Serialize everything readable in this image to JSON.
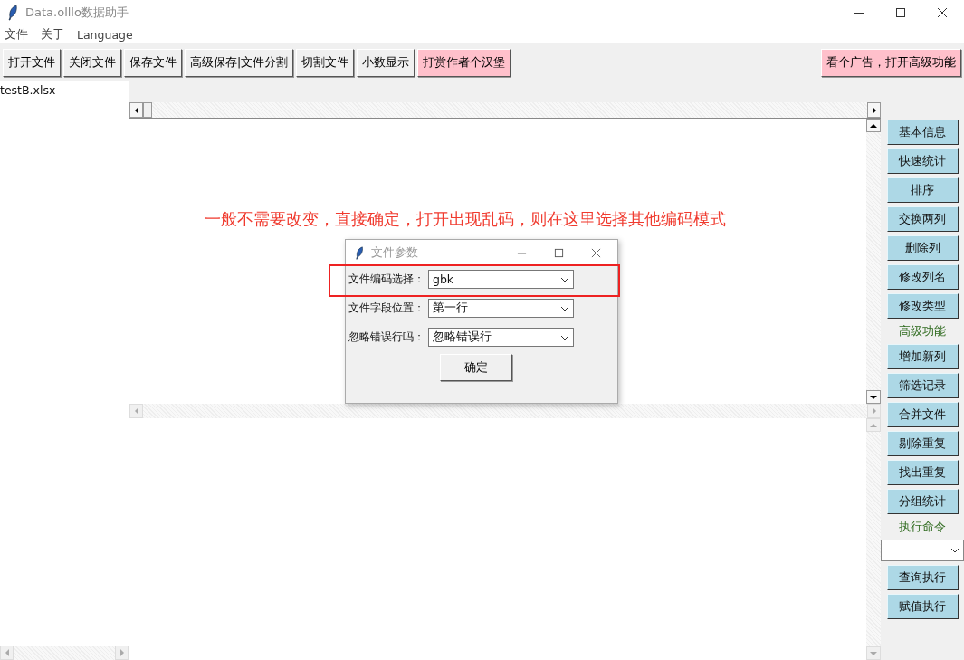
{
  "window": {
    "title": "Data.olllo数据助手"
  },
  "menu": [
    {
      "label": "文件"
    },
    {
      "label": "关于"
    },
    {
      "label": "Language"
    }
  ],
  "toolbar": {
    "buttons": [
      {
        "label": "打开文件",
        "kind": "normal"
      },
      {
        "label": "关闭文件",
        "kind": "normal"
      },
      {
        "label": "保存文件",
        "kind": "normal"
      },
      {
        "label": "高级保存|文件分割",
        "kind": "normal"
      },
      {
        "label": "切割文件",
        "kind": "normal"
      },
      {
        "label": "小数显示",
        "kind": "normal"
      },
      {
        "label": "打赏作者个汉堡",
        "kind": "pink"
      }
    ],
    "right_button": {
      "label": "看个广告，打开高级功能",
      "kind": "pink"
    }
  },
  "file_list": [
    "testB.xlsx"
  ],
  "annotation": "一般不需要改变，直接确定，打开出现乱码，则在这里选择其他编码模式",
  "dialog": {
    "title": "文件参数",
    "fields": [
      {
        "label": "文件编码选择：",
        "value": "gbk"
      },
      {
        "label": "文件字段位置：",
        "value": "第一行"
      },
      {
        "label": "忽略错误行吗：",
        "value": "忽略错误行"
      }
    ],
    "confirm": "确定"
  },
  "side_panel": [
    {
      "kind": "button",
      "label": "基本信息"
    },
    {
      "kind": "button",
      "label": "快速统计"
    },
    {
      "kind": "button",
      "label": "排序"
    },
    {
      "kind": "button",
      "label": "交换两列"
    },
    {
      "kind": "button",
      "label": "删除列"
    },
    {
      "kind": "button",
      "label": "修改列名"
    },
    {
      "kind": "button",
      "label": "修改类型"
    },
    {
      "kind": "heading",
      "label": "高级功能"
    },
    {
      "kind": "button",
      "label": "增加新列"
    },
    {
      "kind": "button",
      "label": "筛选记录"
    },
    {
      "kind": "button",
      "label": "合并文件"
    },
    {
      "kind": "button",
      "label": "剔除重复"
    },
    {
      "kind": "button",
      "label": "找出重复"
    },
    {
      "kind": "button",
      "label": "分组统计"
    },
    {
      "kind": "heading",
      "label": "执行命令"
    },
    {
      "kind": "select"
    },
    {
      "kind": "button",
      "label": "查询执行"
    },
    {
      "kind": "button",
      "label": "赋值执行"
    }
  ]
}
